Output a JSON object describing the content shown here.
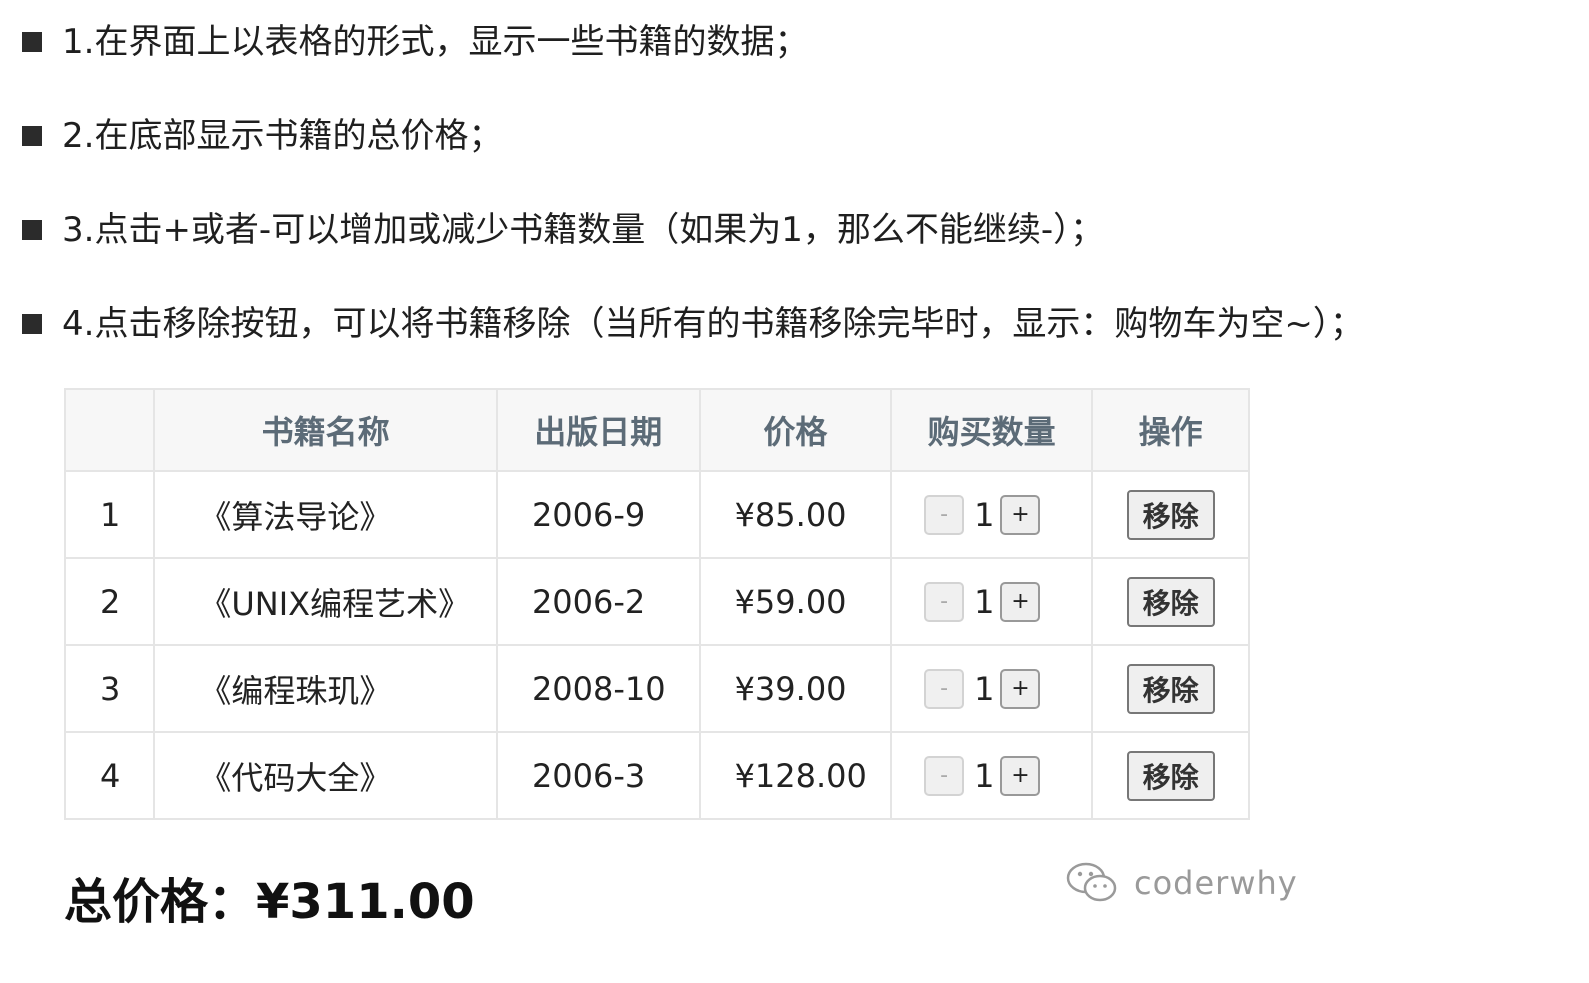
{
  "requirements": [
    "1.在界面上以表格的形式，显示一些书籍的数据；",
    "2.在底部显示书籍的总价格；",
    "3.点击+或者-可以增加或减少书籍数量（如果为1，那么不能继续-）；",
    "4.点击移除按钮，可以将书籍移除（当所有的书籍移除完毕时，显示：购物车为空~）；"
  ],
  "table": {
    "headers": [
      "",
      "书籍名称",
      "出版日期",
      "价格",
      "购买数量",
      "操作"
    ],
    "rows": [
      {
        "index": "1",
        "name": "《算法导论》",
        "date": "2006-9",
        "price": "¥85.00",
        "qty": "1",
        "minus": "-",
        "plus": "+",
        "remove": "移除"
      },
      {
        "index": "2",
        "name": "《UNIX编程艺术》",
        "date": "2006-2",
        "price": "¥59.00",
        "qty": "1",
        "minus": "-",
        "plus": "+",
        "remove": "移除"
      },
      {
        "index": "3",
        "name": "《编程珠玑》",
        "date": "2008-10",
        "price": "¥39.00",
        "qty": "1",
        "minus": "-",
        "plus": "+",
        "remove": "移除"
      },
      {
        "index": "4",
        "name": "《代码大全》",
        "date": "2006-3",
        "price": "¥128.00",
        "qty": "1",
        "minus": "-",
        "plus": "+",
        "remove": "移除"
      }
    ]
  },
  "total": "总价格：¥311.00",
  "watermark": "coderwhy"
}
